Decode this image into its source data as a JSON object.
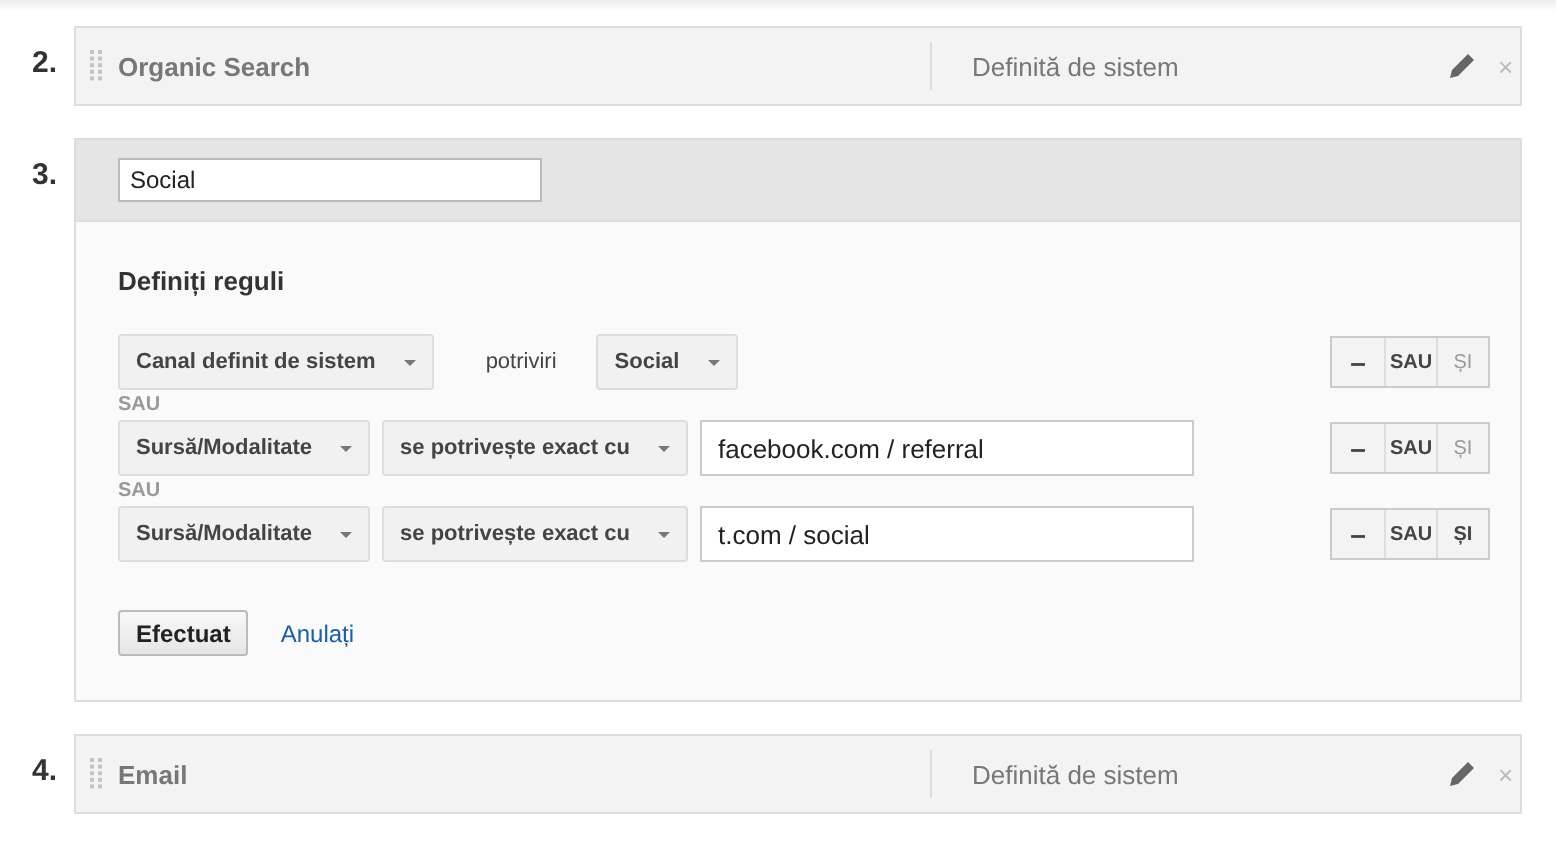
{
  "channels": [
    {
      "number": "2.",
      "expanded": false,
      "name": "Organic Search",
      "type": "Definită de sistem",
      "remove": "×"
    },
    {
      "number": "3.",
      "expanded": true,
      "name": "Social",
      "rules_title": "Definiți reguli",
      "rules": [
        {
          "parts": [
            {
              "kind": "select",
              "text": "Canal definit de sistem"
            },
            {
              "kind": "label",
              "text": "potriviri"
            },
            {
              "kind": "select",
              "text": "Social"
            }
          ],
          "remove": "–",
          "or": "SAU",
          "and": "ȘI",
          "and_disabled": true
        },
        {
          "separator": "SAU",
          "parts": [
            {
              "kind": "select",
              "text": "Sursă/Modalitate"
            },
            {
              "kind": "select",
              "text": "se potrivește exact cu"
            },
            {
              "kind": "input",
              "text": "facebook.com / referral"
            }
          ],
          "remove": "–",
          "or": "SAU",
          "and": "ȘI",
          "and_disabled": true
        },
        {
          "separator": "SAU",
          "parts": [
            {
              "kind": "select",
              "text": "Sursă/Modalitate"
            },
            {
              "kind": "select",
              "text": "se potrivește exact cu"
            },
            {
              "kind": "input",
              "text": "t.com / social"
            }
          ],
          "remove": "–",
          "or": "SAU",
          "and": "ȘI",
          "and_disabled": false
        }
      ],
      "done": "Efectuat",
      "cancel": "Anulați"
    },
    {
      "number": "4.",
      "expanded": false,
      "name": "Email",
      "type": "Definită de sistem",
      "remove": "×"
    }
  ]
}
